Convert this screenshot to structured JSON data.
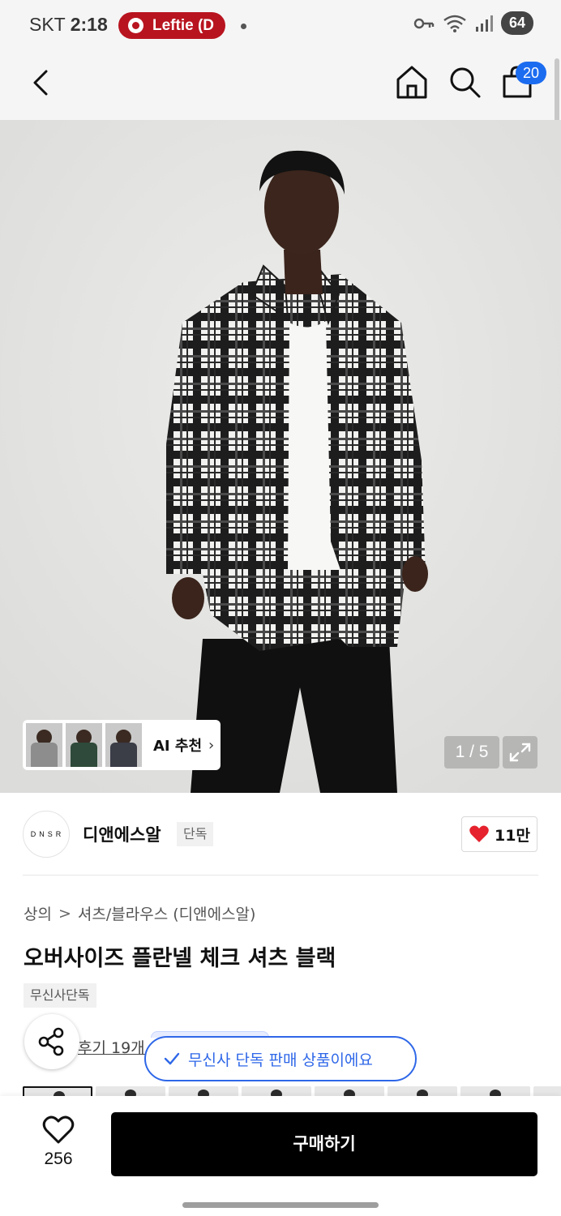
{
  "status_bar": {
    "carrier": "SKT",
    "time": "2:18",
    "recording_app": "Leftie (D",
    "battery": "64"
  },
  "header": {
    "cart_count": "20",
    "icons": [
      "back-arrow-icon",
      "home-icon",
      "search-icon",
      "shopping-bag-icon"
    ]
  },
  "gallery": {
    "page_indicator": "1 / 5",
    "ai_recommend_label": "AI 추천",
    "ai_recommend_chevron": "›",
    "thumbnail_colors": [
      "#8d8d8d",
      "#2f4a3a",
      "#3b3d47"
    ]
  },
  "brand": {
    "logo_text": "DNSR",
    "name": "디앤에스알",
    "tag": "단독",
    "like_count": "11만"
  },
  "product": {
    "breadcrumb": [
      "상의",
      "셔츠/블라우스 (디앤에스알)"
    ],
    "breadcrumb_separator": ">",
    "title": "오버사이즈 플란넬 체크 셔츠 블랙",
    "exclusive_chip": "무신사단독",
    "review_link": "후기 19개",
    "exclusive_tooltip": "무신사 단독 판매 상품이에요"
  },
  "bottom_bar": {
    "wishlist_count": "256",
    "buy_label": "구매하기"
  },
  "colors": {
    "cart_badge": "#1c6cf0",
    "tooltip_accent": "#2e67e8",
    "heart": "#e5222d",
    "recording_pill": "#b8141f",
    "buy_button": "#000000"
  }
}
